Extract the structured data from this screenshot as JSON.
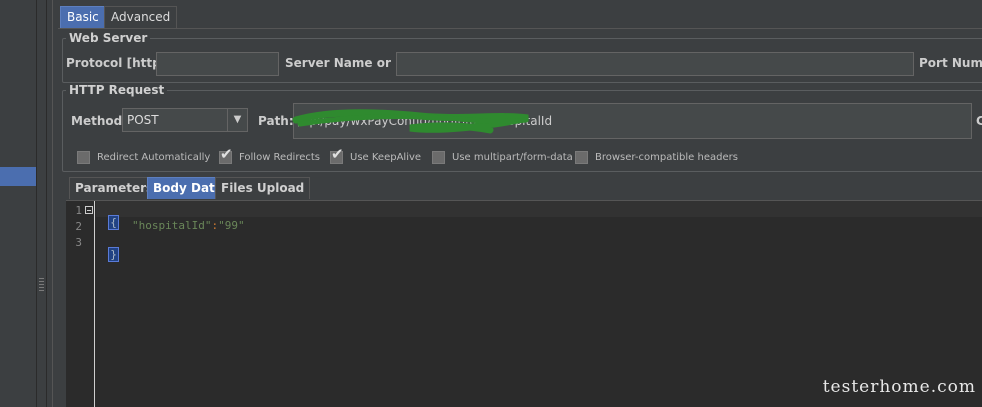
{
  "tabs": {
    "basic": "Basic",
    "advanced": "Advanced"
  },
  "web_server": {
    "legend": "Web Server",
    "protocol_label": "Protocol [http]:",
    "protocol_value": "",
    "server_label": "Server Name or IP:",
    "server_value": "",
    "port_label": "Port Number:"
  },
  "http_request": {
    "legend": "HTTP Request",
    "method_label": "Method:",
    "method_value": "POST",
    "path_label": "Path:",
    "path_value": "/api/pay/wxPayConfig/findInfoByHospitalId",
    "trailing_label": "C"
  },
  "options": [
    {
      "label": "Redirect Automatically",
      "checked": false
    },
    {
      "label": "Follow Redirects",
      "checked": true
    },
    {
      "label": "Use KeepAlive",
      "checked": true
    },
    {
      "label": "Use multipart/form-data",
      "checked": false
    },
    {
      "label": "Browser-compatible headers",
      "checked": false
    }
  ],
  "body_tabs": {
    "parameters": "Parameters",
    "body_data": "Body Data",
    "files_upload": "Files Upload"
  },
  "editor": {
    "line_numbers": [
      "1",
      "2",
      "3"
    ],
    "open_brace": "{",
    "key": "\"hospitalId\"",
    "colon": ":",
    "value": "\"99\"",
    "close_brace": "}"
  },
  "watermark": "testerhome.com",
  "colors": {
    "selection_blue": "#4b6eaf",
    "editor_bg": "#2b2b2b",
    "string_green": "#6a8759"
  }
}
